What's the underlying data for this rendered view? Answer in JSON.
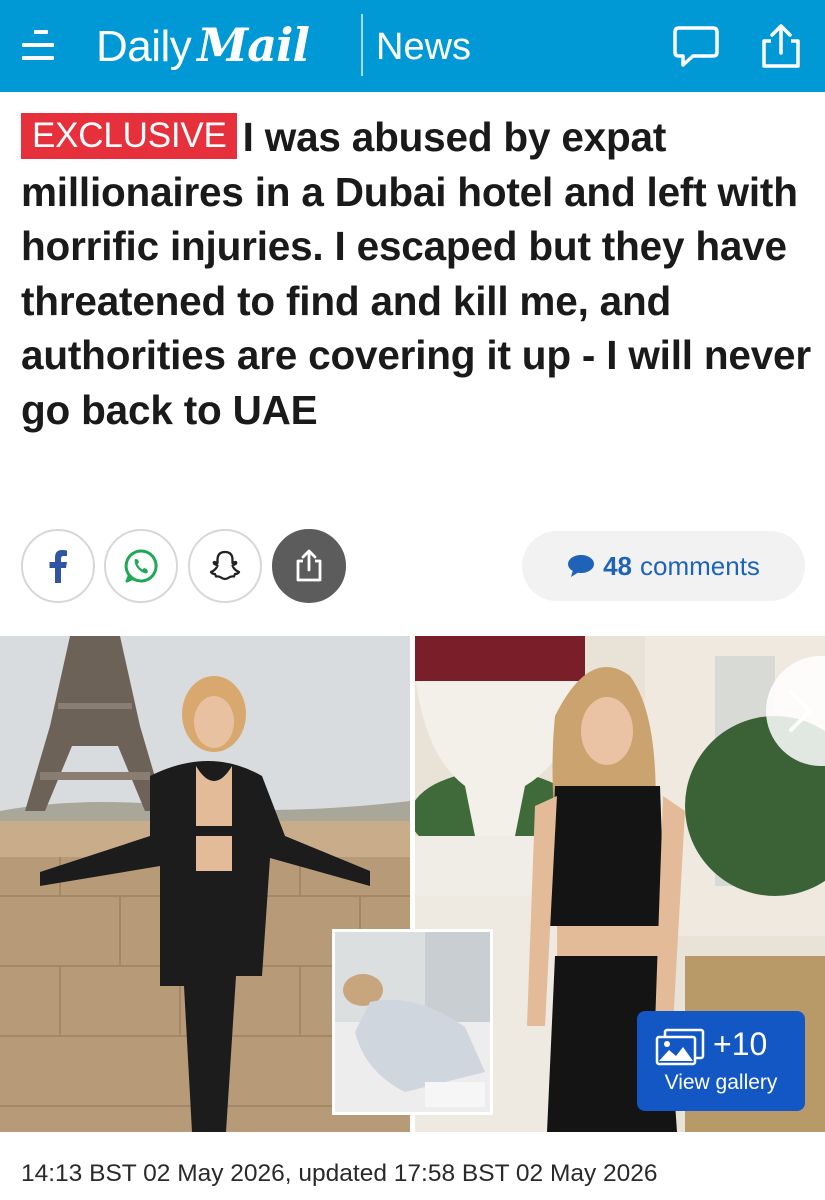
{
  "header": {
    "logo_daily": "Daily",
    "logo_mail": "Mail",
    "section": "News",
    "background_color": "#0099d6"
  },
  "icons": {
    "menu": "hamburger-menu-icon",
    "comment": "speech-bubble-icon",
    "share": "share-upload-icon",
    "facebook": "facebook-icon",
    "whatsapp": "whatsapp-icon",
    "snapchat": "snapchat-icon",
    "gallery": "photo-stack-icon",
    "next": "chevron-right-icon"
  },
  "article": {
    "badge": "EXCLUSIVE",
    "badge_color": "#e6303b",
    "headline": "I was abused by expat millionaires in a Dubai hotel and left with horrific injuries. I escaped but they have threatened to find and kill me, and authorities are covering it up - I will never go back to UAE",
    "comments_count": "48",
    "comments_label": "comments",
    "timestamp": "14:13 BST 02 May 2026, updated 17:58 BST 02 May 2026"
  },
  "gallery": {
    "count": "+10",
    "label": "View gallery",
    "button_color": "#1357c4"
  }
}
